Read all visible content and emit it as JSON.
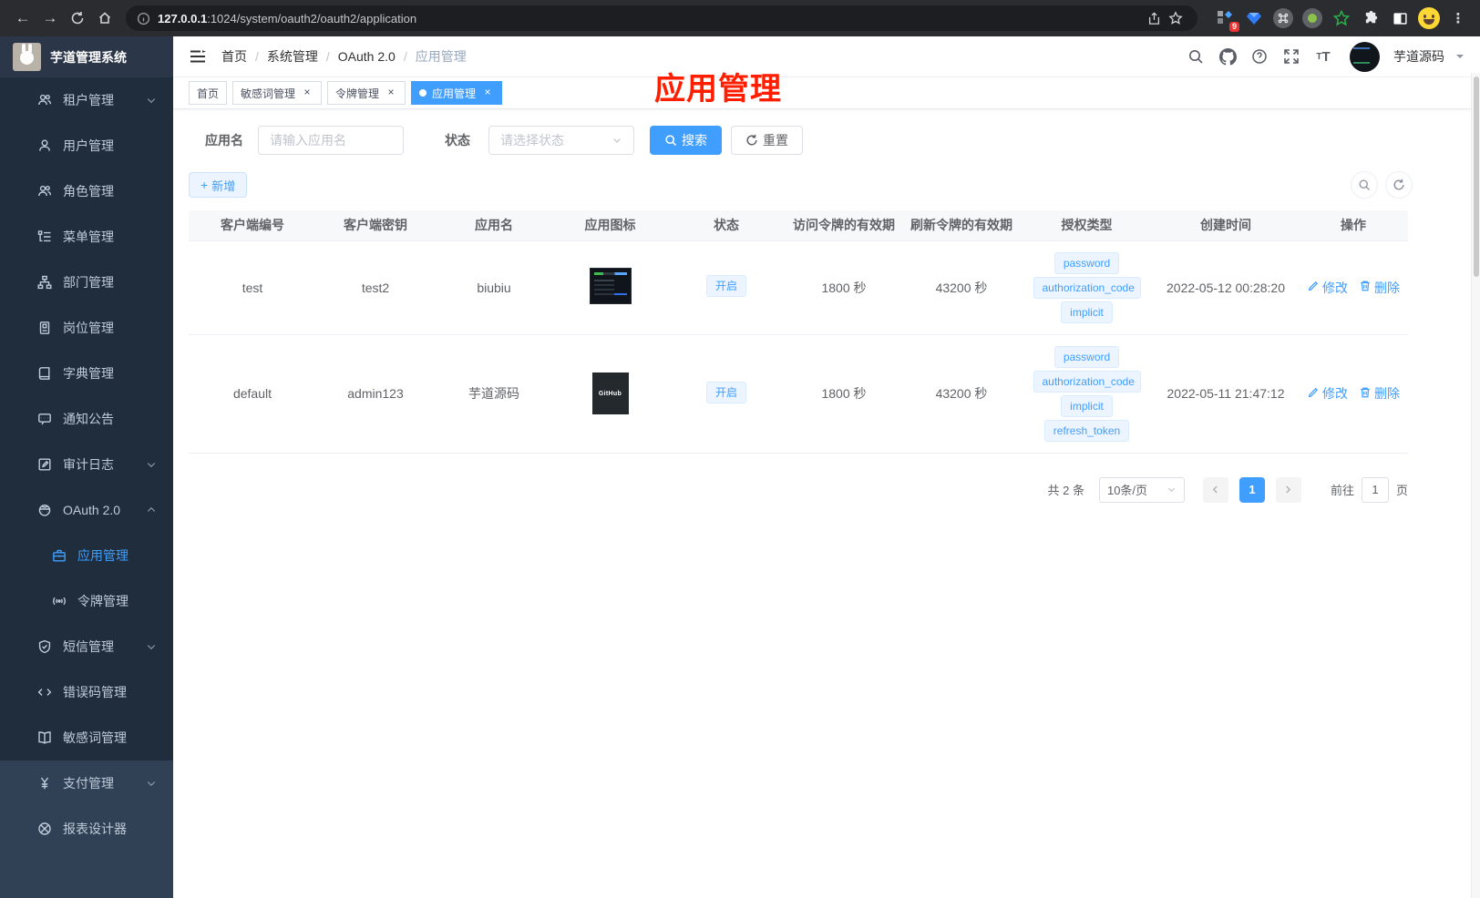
{
  "browser": {
    "url_host": "127.0.0.1",
    "url_path": ":1024/system/oauth2/oauth2/application",
    "extension_badge": "9"
  },
  "colors": {
    "accent": "#409eff",
    "annotation_red": "#ff1e00",
    "sidebar_bg": "#304156",
    "submenu_bg": "#1f2d3d"
  },
  "sidebar": {
    "title": "芋道管理系统",
    "items": [
      {
        "label": "租户管理",
        "icon": "tenant-users-icon",
        "section": "sub",
        "chevron": "down"
      },
      {
        "label": "用户管理",
        "icon": "user-icon",
        "section": "sub"
      },
      {
        "label": "角色管理",
        "icon": "role-users-icon",
        "section": "sub"
      },
      {
        "label": "菜单管理",
        "icon": "menu-tree-icon",
        "section": "sub"
      },
      {
        "label": "部门管理",
        "icon": "org-chart-icon",
        "section": "sub"
      },
      {
        "label": "岗位管理",
        "icon": "post-badge-icon",
        "section": "sub"
      },
      {
        "label": "字典管理",
        "icon": "dictionary-icon",
        "section": "sub"
      },
      {
        "label": "通知公告",
        "icon": "notice-message-icon",
        "section": "sub"
      },
      {
        "label": "审计日志",
        "icon": "audit-log-icon",
        "section": "sub",
        "chevron": "down"
      },
      {
        "label": "OAuth 2.0",
        "icon": "oauth-icon",
        "section": "sub",
        "chevron": "up"
      },
      {
        "label": "应用管理",
        "icon": "application-briefcase-icon",
        "section": "sub",
        "indent": 2,
        "active": true
      },
      {
        "label": "令牌管理",
        "icon": "token-signal-icon",
        "section": "sub",
        "indent": 2
      },
      {
        "label": "短信管理",
        "icon": "sms-shield-icon",
        "section": "sub",
        "chevron": "down"
      },
      {
        "label": "错误码管理",
        "icon": "errorcode-icon",
        "section": "sub"
      },
      {
        "label": "敏感词管理",
        "icon": "sensitive-word-book-icon",
        "section": "sub"
      },
      {
        "label": "支付管理",
        "icon": "pay-yen-icon",
        "section": "root",
        "chevron": "down"
      },
      {
        "label": "报表设计器",
        "icon": "report-designer-icon",
        "section": "root"
      }
    ]
  },
  "header": {
    "breadcrumb": [
      "首页",
      "系统管理",
      "OAuth 2.0",
      "应用管理"
    ],
    "username": "芋道源码"
  },
  "tabs": [
    {
      "label": "首页"
    },
    {
      "label": "敏感词管理",
      "closable": true
    },
    {
      "label": "令牌管理",
      "closable": true
    },
    {
      "label": "应用管理",
      "closable": true,
      "active": true
    }
  ],
  "annotation": {
    "text": "应用管理"
  },
  "filters": {
    "name_label": "应用名",
    "name_placeholder": "请输入应用名",
    "status_label": "状态",
    "status_placeholder": "请选择状态",
    "search_label": "搜索",
    "reset_label": "重置",
    "add_label": "新增"
  },
  "table": {
    "headers": [
      "客户端编号",
      "客户端密钥",
      "应用名",
      "应用图标",
      "状态",
      "访问令牌的有效期",
      "刷新令牌的有效期",
      "授权类型",
      "创建时间",
      "操作"
    ],
    "actions": {
      "edit": "修改",
      "delete": "删除"
    },
    "rows": [
      {
        "client_id": "test",
        "secret": "test2",
        "name": "biubiu",
        "icon": "dashboard",
        "icon_label": "",
        "status": "开启",
        "access_ttl": "1800 秒",
        "refresh_ttl": "43200 秒",
        "grants": [
          "password",
          "authorization_code",
          "implicit"
        ],
        "created": "2022-05-12 00:28:20"
      },
      {
        "client_id": "default",
        "secret": "admin123",
        "name": "芋道源码",
        "icon": "github",
        "icon_label": "GitHub",
        "status": "开启",
        "access_ttl": "1800 秒",
        "refresh_ttl": "43200 秒",
        "grants": [
          "password",
          "authorization_code",
          "implicit",
          "refresh_token"
        ],
        "created": "2022-05-11 21:47:12"
      }
    ]
  },
  "pagination": {
    "total": "共 2 条",
    "per_page": "10条/页",
    "current_page": "1",
    "goto_label": "前往",
    "goto_value": "1",
    "page_suffix": "页"
  }
}
